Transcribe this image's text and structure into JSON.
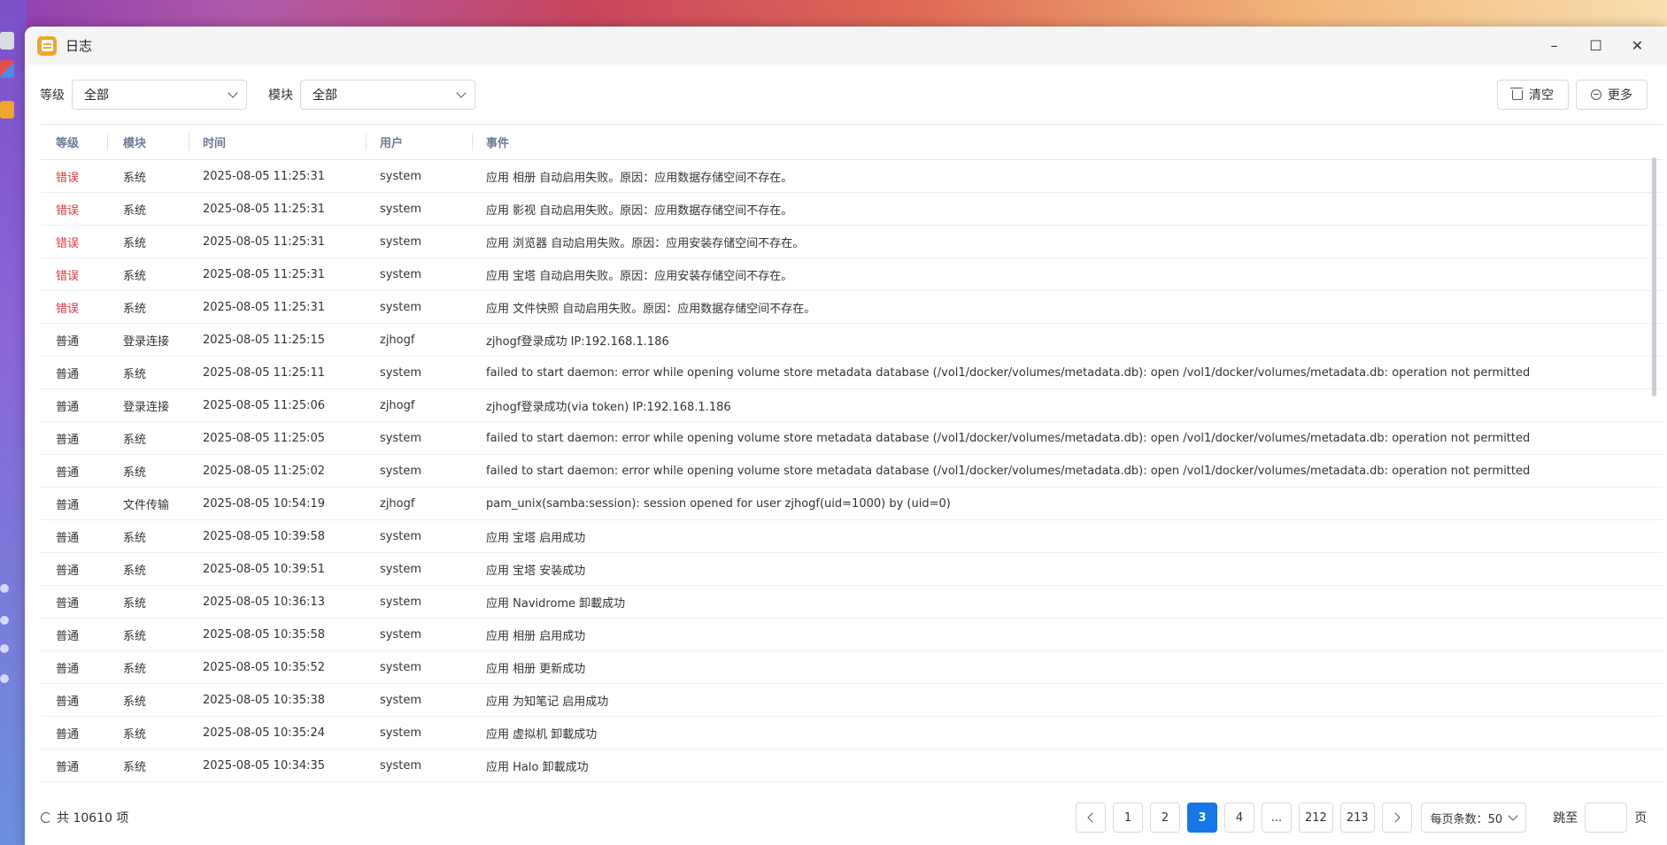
{
  "window": {
    "title": "日志",
    "minimize": "–",
    "maximize": "☐",
    "close": "✕"
  },
  "filters": {
    "level_label": "等级",
    "level_value": "全部",
    "module_label": "模块",
    "module_value": "全部"
  },
  "actions": {
    "clear": "清空",
    "more": "更多"
  },
  "columns": [
    "等级",
    "模块",
    "时间",
    "用户",
    "事件"
  ],
  "rows": [
    {
      "level": "错误",
      "module": "系统",
      "time": "2025-08-05 11:25:31",
      "user": "system",
      "event": "应用 相册 自动启用失败。原因：应用数据存储空间不存在。"
    },
    {
      "level": "错误",
      "module": "系统",
      "time": "2025-08-05 11:25:31",
      "user": "system",
      "event": "应用 影视 自动启用失败。原因：应用数据存储空间不存在。"
    },
    {
      "level": "错误",
      "module": "系统",
      "time": "2025-08-05 11:25:31",
      "user": "system",
      "event": "应用 浏览器 自动启用失败。原因：应用安装存储空间不存在。"
    },
    {
      "level": "错误",
      "module": "系统",
      "time": "2025-08-05 11:25:31",
      "user": "system",
      "event": "应用 宝塔 自动启用失败。原因：应用安装存储空间不存在。"
    },
    {
      "level": "错误",
      "module": "系统",
      "time": "2025-08-05 11:25:31",
      "user": "system",
      "event": "应用 文件快照 自动启用失败。原因：应用数据存储空间不存在。"
    },
    {
      "level": "普通",
      "module": "登录连接",
      "time": "2025-08-05 11:25:15",
      "user": "zjhogf",
      "event": "zjhogf登录成功 IP:192.168.1.186"
    },
    {
      "level": "普通",
      "module": "系统",
      "time": "2025-08-05 11:25:11",
      "user": "system",
      "event": "failed to start daemon: error while opening volume store metadata database (/vol1/docker/volumes/metadata.db): open /vol1/docker/volumes/metadata.db: operation not permitted"
    },
    {
      "level": "普通",
      "module": "登录连接",
      "time": "2025-08-05 11:25:06",
      "user": "zjhogf",
      "event": "zjhogf登录成功(via token) IP:192.168.1.186"
    },
    {
      "level": "普通",
      "module": "系统",
      "time": "2025-08-05 11:25:05",
      "user": "system",
      "event": "failed to start daemon: error while opening volume store metadata database (/vol1/docker/volumes/metadata.db): open /vol1/docker/volumes/metadata.db: operation not permitted"
    },
    {
      "level": "普通",
      "module": "系统",
      "time": "2025-08-05 11:25:02",
      "user": "system",
      "event": "failed to start daemon: error while opening volume store metadata database (/vol1/docker/volumes/metadata.db): open /vol1/docker/volumes/metadata.db: operation not permitted"
    },
    {
      "level": "普通",
      "module": "文件传输",
      "time": "2025-08-05 10:54:19",
      "user": "zjhogf",
      "event": "pam_unix(samba:session): session opened for user zjhogf(uid=1000) by (uid=0)"
    },
    {
      "level": "普通",
      "module": "系统",
      "time": "2025-08-05 10:39:58",
      "user": "system",
      "event": "应用 宝塔 启用成功"
    },
    {
      "level": "普通",
      "module": "系统",
      "time": "2025-08-05 10:39:51",
      "user": "system",
      "event": "应用 宝塔 安装成功"
    },
    {
      "level": "普通",
      "module": "系统",
      "time": "2025-08-05 10:36:13",
      "user": "system",
      "event": "应用 Navidrome 卸載成功"
    },
    {
      "level": "普通",
      "module": "系统",
      "time": "2025-08-05 10:35:58",
      "user": "system",
      "event": "应用 相册 启用成功"
    },
    {
      "level": "普通",
      "module": "系统",
      "time": "2025-08-05 10:35:52",
      "user": "system",
      "event": "应用 相册 更新成功"
    },
    {
      "level": "普通",
      "module": "系统",
      "time": "2025-08-05 10:35:38",
      "user": "system",
      "event": "应用 为知笔记 启用成功"
    },
    {
      "level": "普通",
      "module": "系统",
      "time": "2025-08-05 10:35:24",
      "user": "system",
      "event": "应用 虚拟机 卸載成功"
    },
    {
      "level": "普通",
      "module": "系统",
      "time": "2025-08-05 10:34:35",
      "user": "system",
      "event": "应用 Halo 卸載成功"
    }
  ],
  "footer": {
    "total": "共 10610 项",
    "pages": [
      "1",
      "2",
      "3",
      "4",
      "...",
      "212",
      "213"
    ],
    "current_page": "3",
    "per_page": "每页条数：50",
    "jump_label": "跳至",
    "page_unit": "页"
  },
  "colors": {
    "error": "#e0343a",
    "accent": "#1677e6",
    "app_icon": "#f0a52b"
  }
}
